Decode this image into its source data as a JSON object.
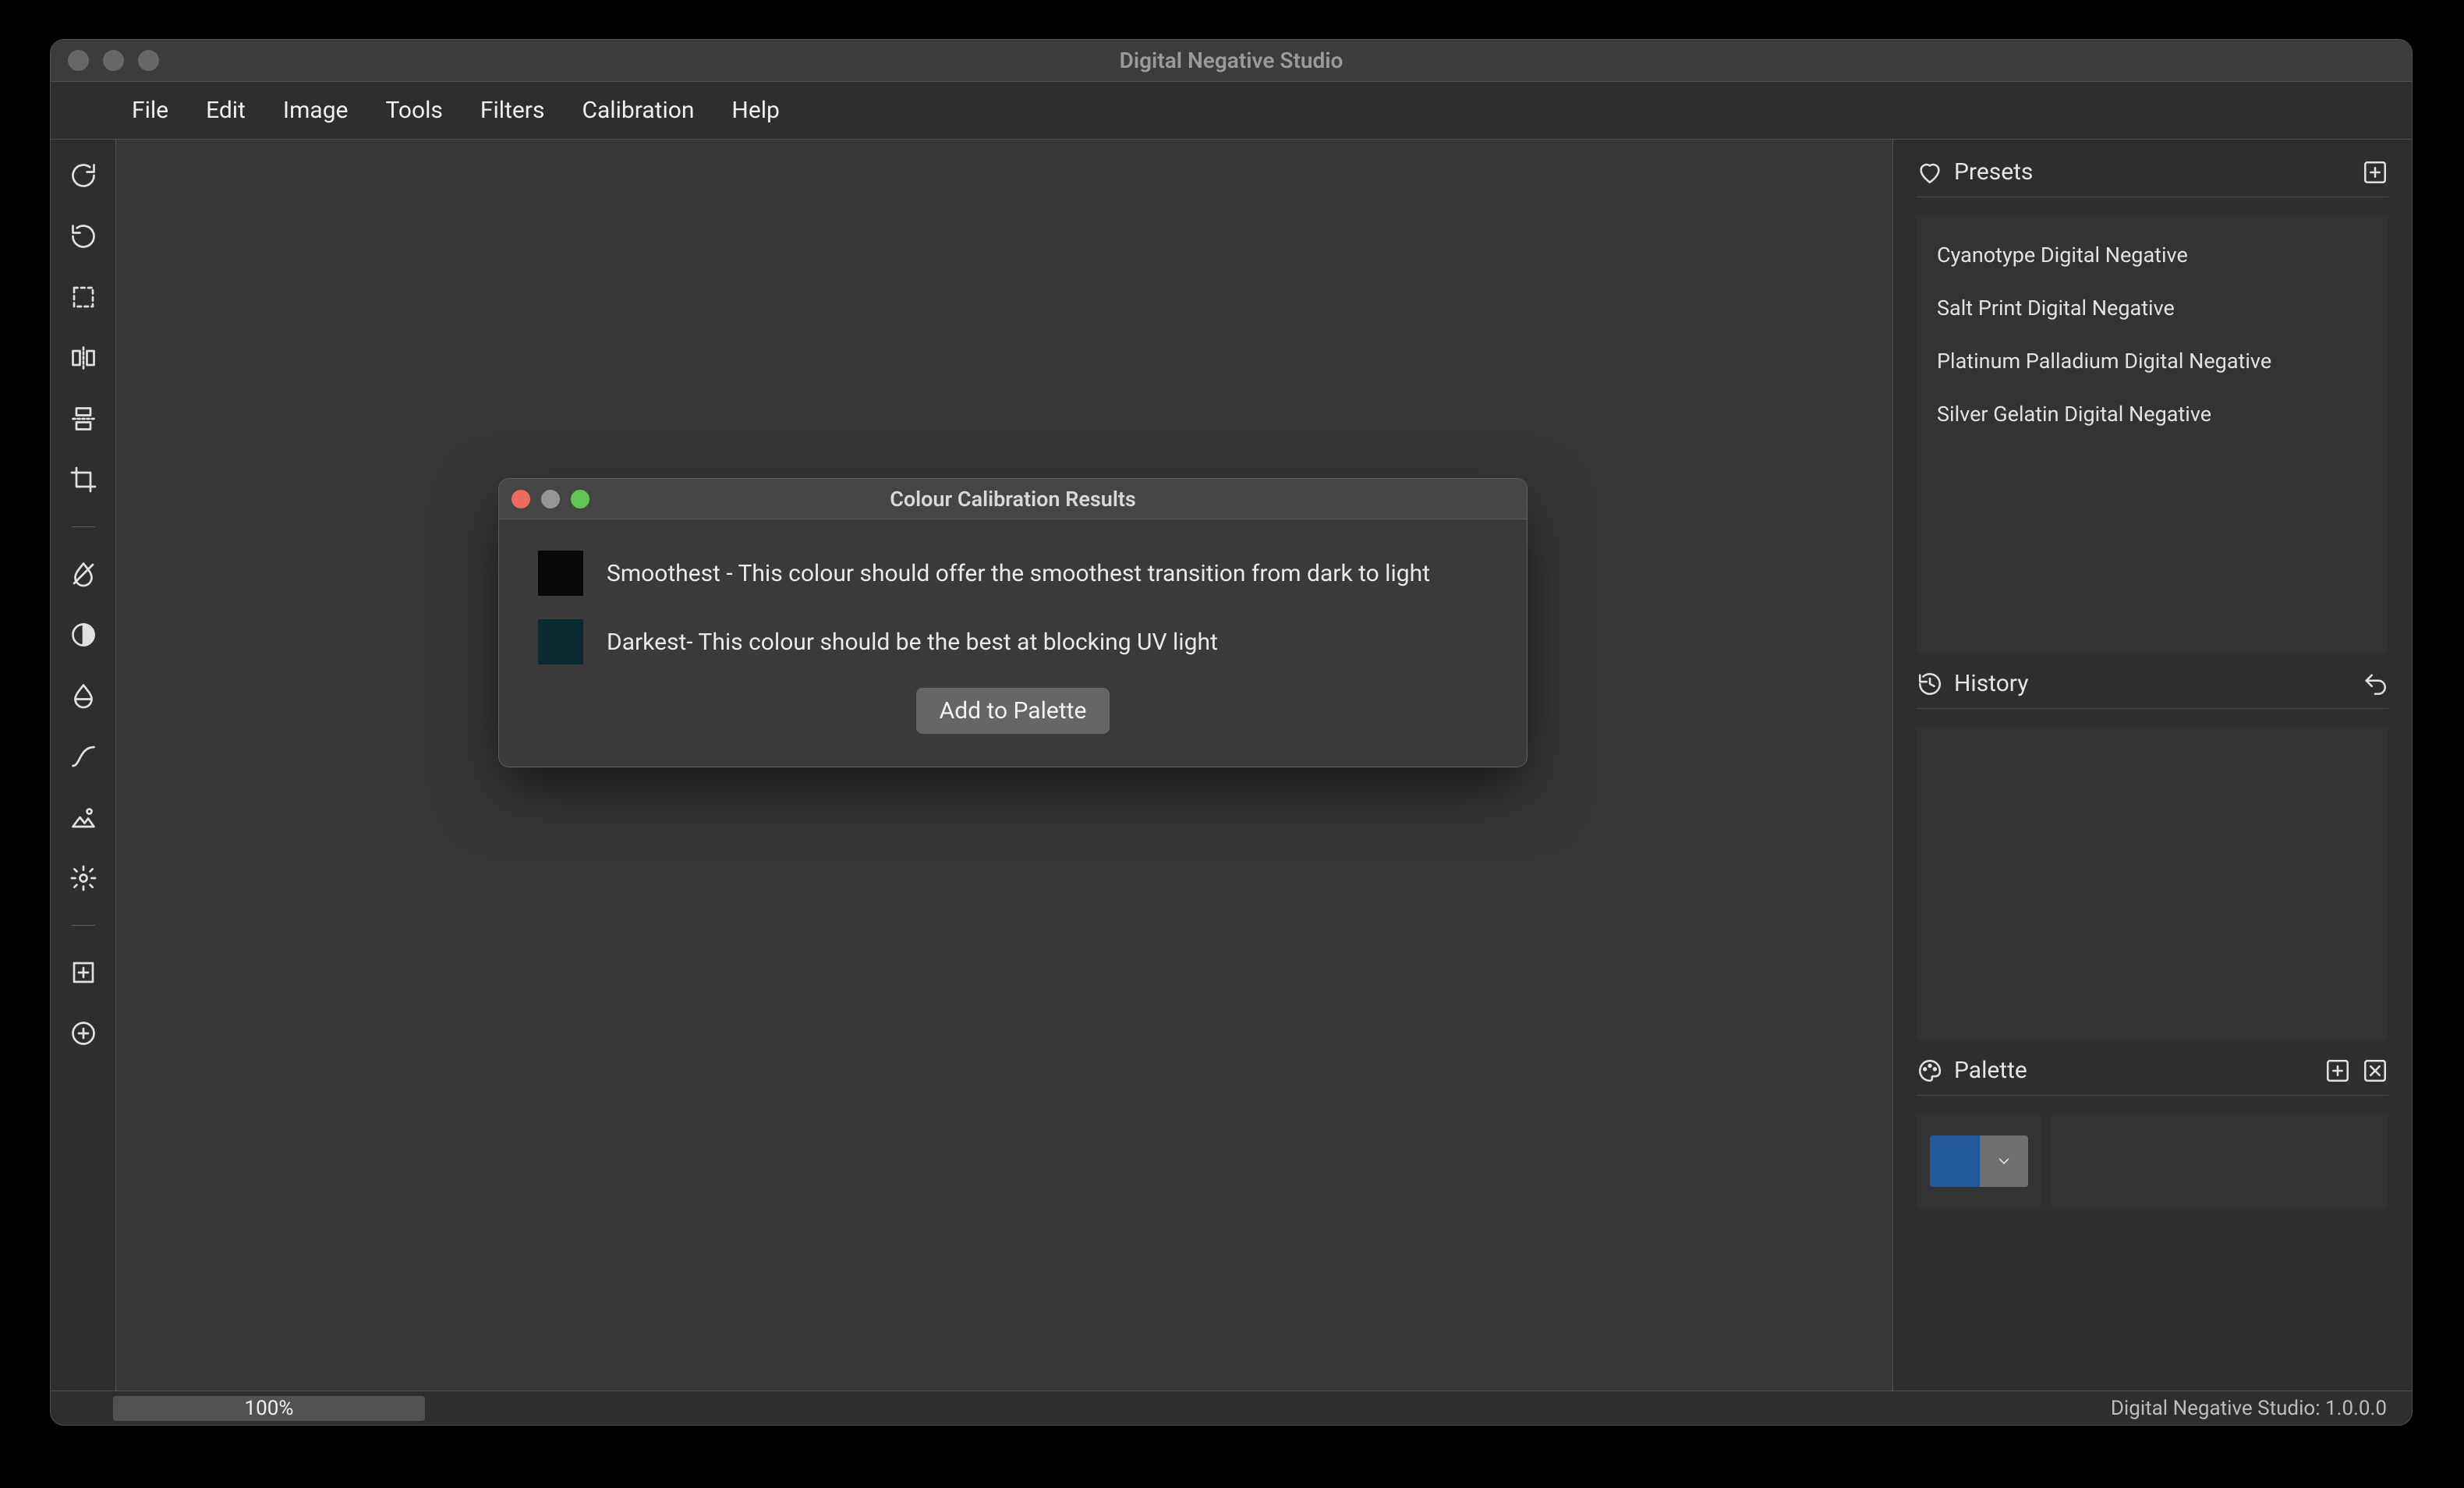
{
  "window": {
    "title": "Digital Negative Studio"
  },
  "menubar": {
    "items": [
      "File",
      "Edit",
      "Image",
      "Tools",
      "Filters",
      "Calibration",
      "Help"
    ]
  },
  "dialog": {
    "title": "Colour Calibration Results",
    "results": [
      {
        "color": "#070707",
        "text": "Smoothest - This colour should offer the smoothest transition from dark to light"
      },
      {
        "color": "#0b2a30",
        "text": "Darkest- This colour should be the best at blocking UV light"
      }
    ],
    "button": "Add to Palette"
  },
  "right": {
    "presets": {
      "title": "Presets",
      "items": [
        "Cyanotype Digital Negative",
        "Salt Print Digital Negative",
        "Platinum Palladium Digital Negative",
        "Silver Gelatin Digital Negative"
      ]
    },
    "history": {
      "title": "History"
    },
    "palette": {
      "title": "Palette",
      "current_color": "#205a9c"
    }
  },
  "statusbar": {
    "zoom": "100%",
    "version": "Digital Negative Studio: 1.0.0.0"
  }
}
